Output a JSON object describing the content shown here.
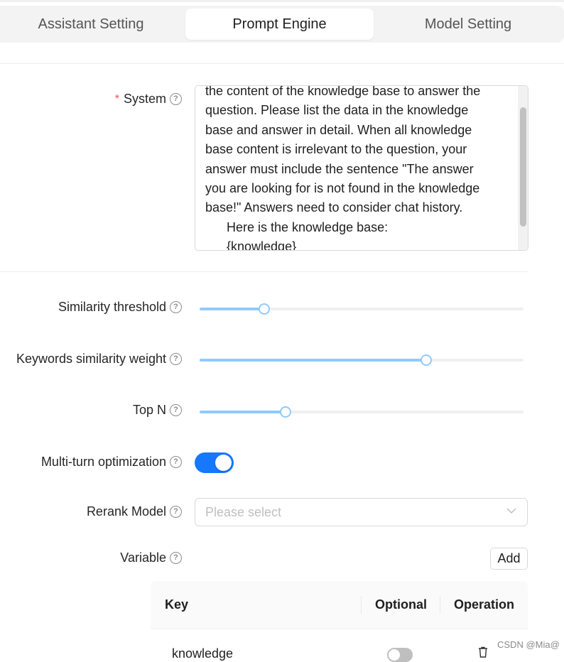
{
  "tabs": [
    {
      "label": "Assistant Setting",
      "active": false
    },
    {
      "label": "Prompt Engine",
      "active": true
    },
    {
      "label": "Model Setting",
      "active": false
    }
  ],
  "system": {
    "label": "System",
    "required_mark": "*",
    "text_lines": [
      "the content of the knowledge base to answer the",
      "question. Please list the data in the knowledge",
      "base and answer in detail. When all knowledge",
      "base content is irrelevant to the question, your",
      "answer must include the sentence \"The answer",
      "you are looking for is not found in the knowledge",
      "base!\" Answers need to consider chat history.",
      "Here is the knowledge base:",
      "{knowledge}"
    ]
  },
  "similarity_threshold": {
    "label": "Similarity threshold",
    "value_fraction": 0.2
  },
  "keywords_similarity_weight": {
    "label": "Keywords similarity weight",
    "value_fraction": 0.7
  },
  "top_n": {
    "label": "Top N",
    "value_fraction": 0.265
  },
  "multi_turn": {
    "label": "Multi-turn optimization",
    "enabled": true
  },
  "rerank_model": {
    "label": "Rerank Model",
    "placeholder": "Please select"
  },
  "variable": {
    "label": "Variable",
    "add_label": "Add",
    "columns": [
      "Key",
      "Optional",
      "Operation"
    ],
    "rows": [
      {
        "key": "knowledge",
        "optional": false
      }
    ]
  },
  "help_glyph": "?",
  "watermark": "CSDN @Mia@",
  "colors": {
    "accent": "#1677ff",
    "slider": "#91caff",
    "required": "#ff4d4f"
  }
}
